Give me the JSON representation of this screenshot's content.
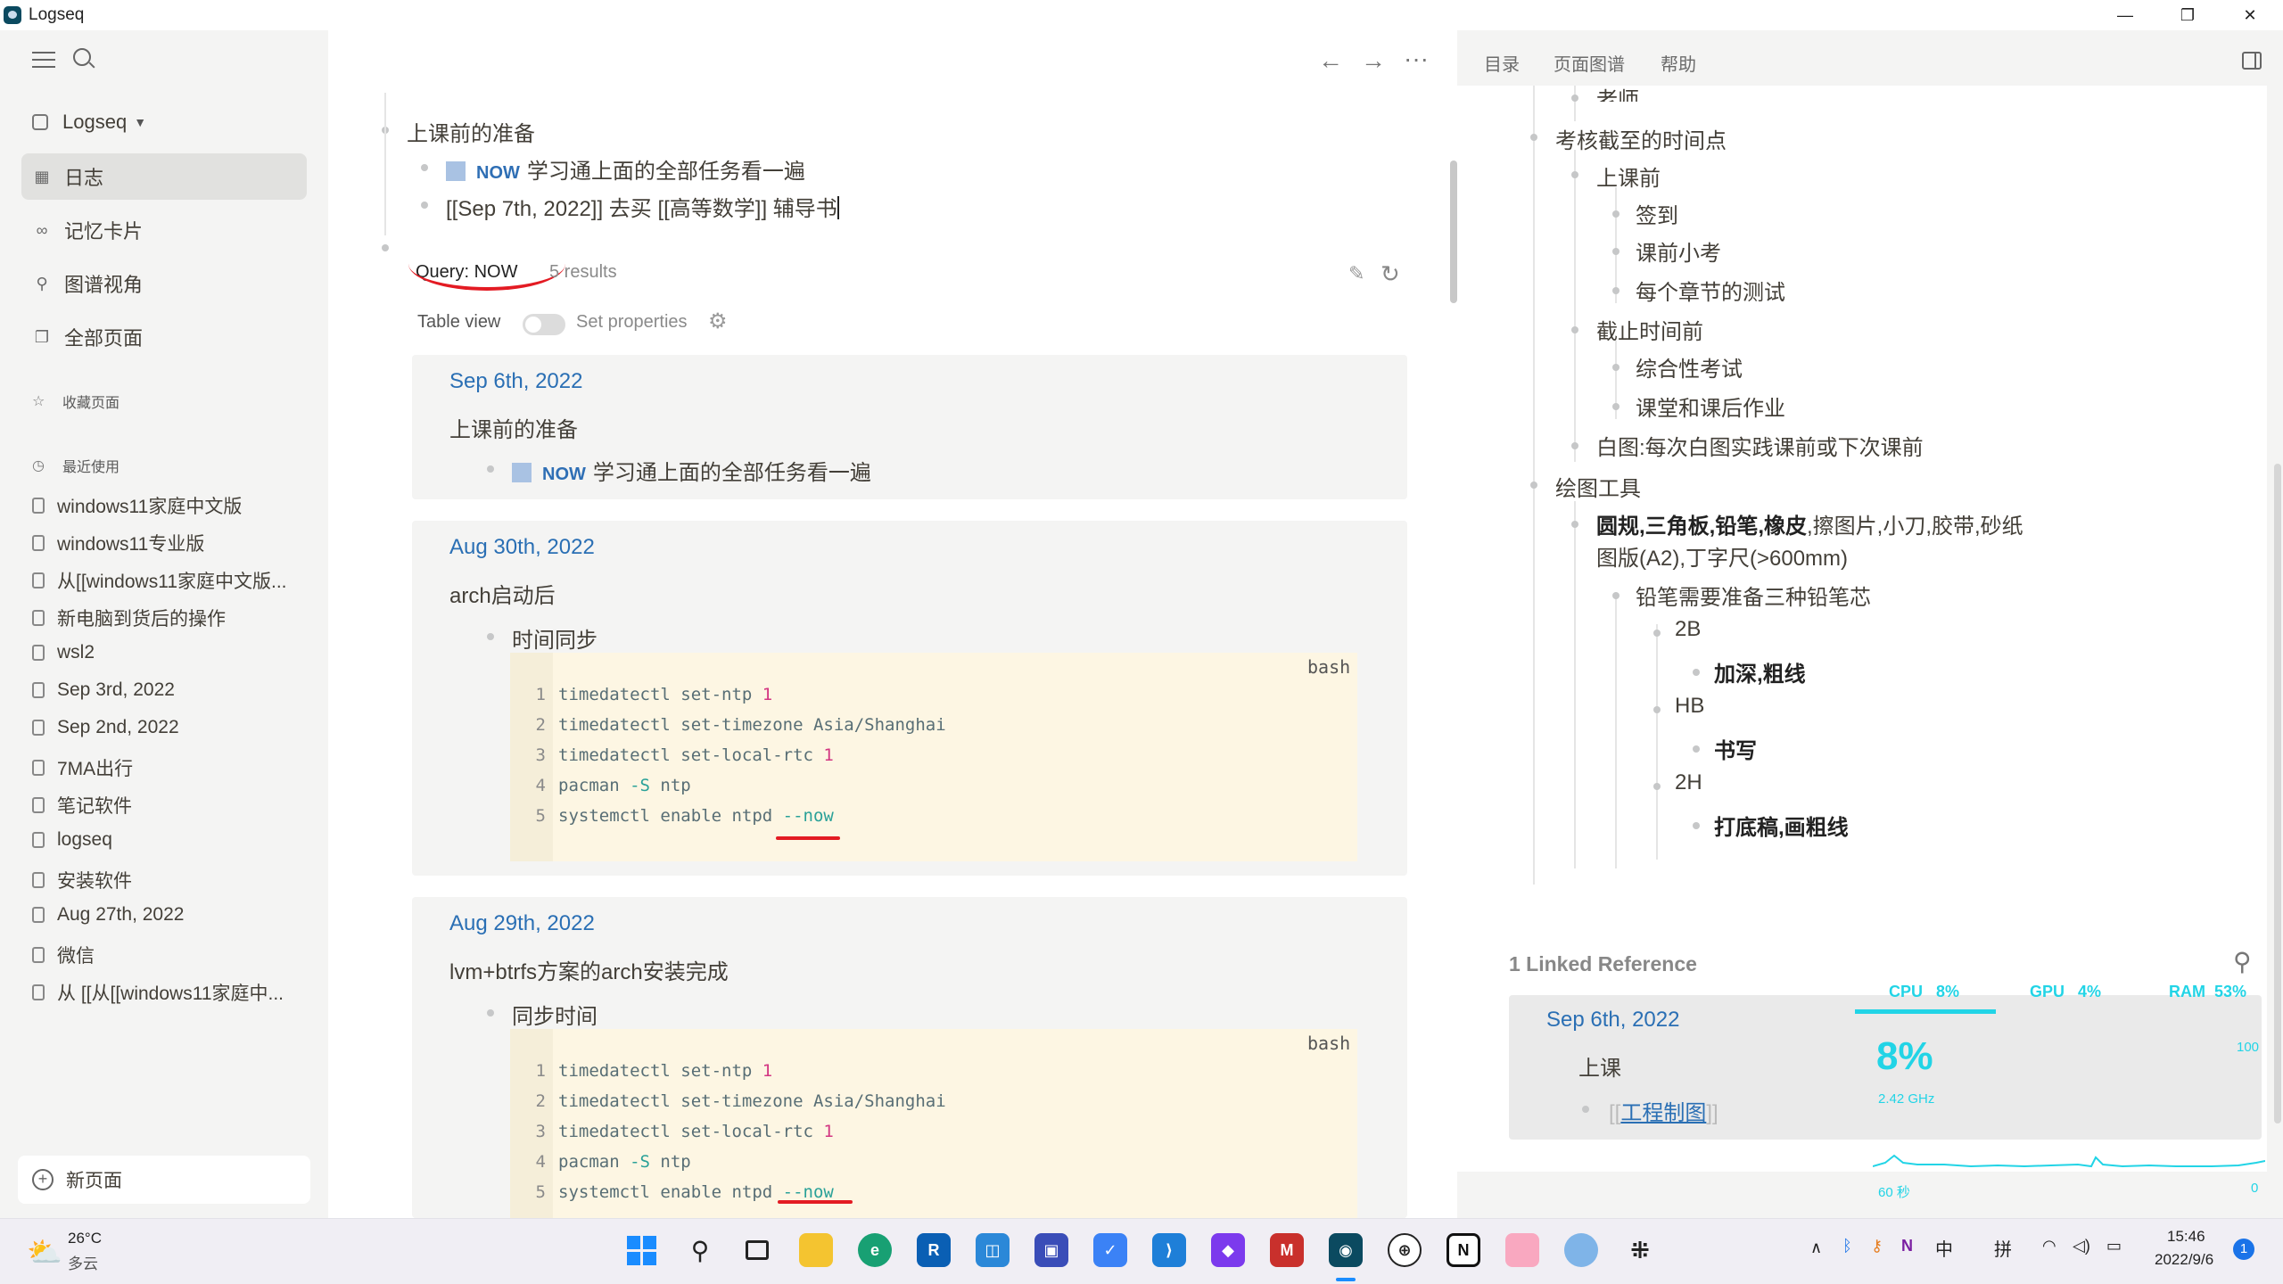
{
  "window": {
    "title": "Logseq"
  },
  "sidebar": {
    "graph_name": "Logseq",
    "nav": [
      {
        "label": "日志",
        "icon": "calendar-icon"
      },
      {
        "label": "记忆卡片",
        "icon": "infinity-icon"
      },
      {
        "label": "图谱视角",
        "icon": "graph-icon"
      },
      {
        "label": "全部页面",
        "icon": "pages-icon"
      }
    ],
    "favorites_title": "收藏页面",
    "recent_title": "最近使用",
    "recent": [
      "windows11家庭中文版",
      "windows11专业版",
      "从[[windows11家庭中文版...",
      "新电脑到货后的操作",
      "wsl2",
      "Sep 3rd, 2022",
      "Sep 2nd, 2022",
      "7MA出行",
      "笔记软件",
      "logseq",
      "安装软件",
      "Aug 27th, 2022",
      "微信",
      "从 [[从[[windows11家庭中..."
    ],
    "new_page": "新页面"
  },
  "main": {
    "block_prep": "上课前的准备",
    "now_marker": "NOW",
    "now_task": "学习通上面的全部任务看一遍",
    "todo_line": "[[Sep 7th, 2022]] 去买 [[高等数学]] 辅导书",
    "query_title": "Query: NOW",
    "query_count": "5 results",
    "table_view": "Table view",
    "set_properties": "Set properties",
    "results": [
      {
        "date": "Sep 6th, 2022",
        "parent": "上课前的准备",
        "child": "学习通上面的全部任务看一遍"
      },
      {
        "date": "Aug 30th, 2022",
        "parent": "arch启动后",
        "child": "时间同步",
        "lang": "bash"
      },
      {
        "date": "Aug 29th, 2022",
        "parent": "lvm+btrfs方案的arch安装完成",
        "child": "同步时间",
        "lang": "bash"
      }
    ],
    "code_lines": [
      {
        "n": "1",
        "pre": "timedatectl set-ntp ",
        "num": "1",
        "flag": "",
        "post": ""
      },
      {
        "n": "2",
        "pre": "timedatectl set-timezone Asia/Shanghai",
        "num": "",
        "flag": "",
        "post": ""
      },
      {
        "n": "3",
        "pre": "timedatectl set-local-rtc ",
        "num": "1",
        "flag": "",
        "post": ""
      },
      {
        "n": "4",
        "pre": "pacman ",
        "num": "",
        "flag": "-S",
        "post": " ntp"
      },
      {
        "n": "5",
        "pre": "systemctl enable ntpd ",
        "num": "",
        "flag": "--now",
        "post": ""
      }
    ]
  },
  "right_panel": {
    "tabs": [
      "目录",
      "页面图谱",
      "帮助"
    ],
    "outline": {
      "teacher": "老师",
      "deadline": "考核截至的时间点",
      "before_class": "上课前",
      "sign_in": "签到",
      "quiz": "课前小考",
      "chapter_test": "每个章节的测试",
      "before_deadline": "截止时间前",
      "exam": "综合性考试",
      "homework": "课堂和课后作业",
      "whiteboard": "白图:每次白图实践课前或下次课前",
      "drawing_tools": "绘图工具",
      "tools_bold": "圆规,三角板,铅笔,橡皮",
      "tools_rest": ",擦图片,小刀,胶带,砂纸",
      "tools_line2": "图版(A2),丁字尺(>600mm)",
      "pencil_prep": "铅笔需要准备三种铅笔芯",
      "p2b": "2B",
      "p2b_use": "加深,粗线",
      "phb": "HB",
      "phb_use": "书写",
      "p2h": "2H",
      "p2h_use": "打底稿,画粗线"
    },
    "linked_refs_title": "1 Linked Reference",
    "linked_ref": {
      "date": "Sep 6th, 2022",
      "parent": "上课",
      "link": "工程制图"
    }
  },
  "perf_widget": {
    "cpu_label": "CPU",
    "cpu_value": "8%",
    "gpu_label": "GPU",
    "gpu_value": "4%",
    "ram_label": "RAM",
    "ram_value": "53%",
    "big_value": "8%",
    "freq": "2.42 GHz",
    "max": "100",
    "time_span": "60 秒",
    "min": "0"
  },
  "taskbar": {
    "weather_temp": "26°C",
    "weather_desc": "多云",
    "ime_lang": "中",
    "ime_mode": "拼",
    "time": "15:46",
    "date": "2022/9/6",
    "notif_count": "1"
  }
}
